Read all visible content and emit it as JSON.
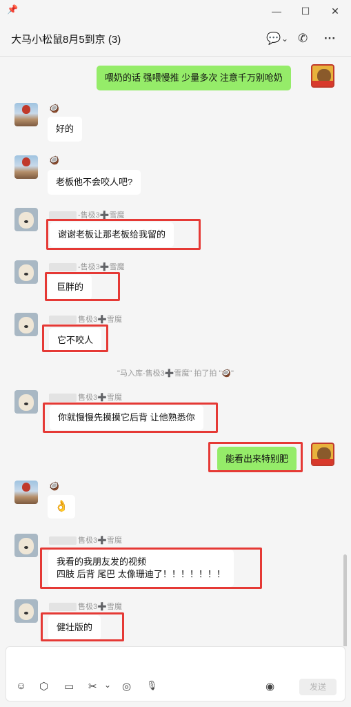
{
  "window": {
    "pin_icon": "pin-icon",
    "min": "—",
    "max": "☐",
    "close": "✕"
  },
  "header": {
    "title": "大马小松鼠8月5到京 (3)",
    "chat_icon": "chat-bubble-icon",
    "chevron": "⌄",
    "call_icon": "phone-icon",
    "more": "···"
  },
  "messages": {
    "m1": "喂奶的话 强喂慢推 少量多次 注意千万别呛奶",
    "m2": "好的",
    "m3": "老板他不会咬人吧?",
    "m4_sender": "-售极3➕雪魔",
    "m4": "谢谢老板让那老板给我留的",
    "m5_sender": "-售极3➕雪魔",
    "m5": "巨胖的",
    "m6_sender": "售极3➕雪魔",
    "m6": "它不咬人",
    "system": "\"马入库-售极3➕雪魔\" 拍了拍 \"🥥\"",
    "m7_sender": "售极3➕雪魔",
    "m7": "你就慢慢先摸摸它后背 让他熟悉你",
    "m8": "能看出来特别肥",
    "m9_sender_emoji": "🥥",
    "m9": "👌",
    "m10_sender": "售极3➕雪魔",
    "m10": "我看的我朋友发的视频\n四肢 后背 尾巴 太像珊迪了！！！！！！！",
    "m11_sender": "售极3➕雪魔",
    "m11": "健壮版的",
    "balloon_sender_emoji": "🥥"
  },
  "composer": {
    "emoji_icon": "☺",
    "box_icon": "⬡",
    "folder_icon": "▭",
    "scissors_icon": "✂",
    "scissors_chevron": "⌄",
    "record_icon": "◎",
    "mic_icon": "🎙",
    "voice_icon": "◉",
    "send_label": "发送"
  },
  "colors": {
    "my_bubble": "#95ec69",
    "other_bubble": "#ffffff",
    "highlight_box": "#e53935",
    "background": "#f5f5f5"
  }
}
